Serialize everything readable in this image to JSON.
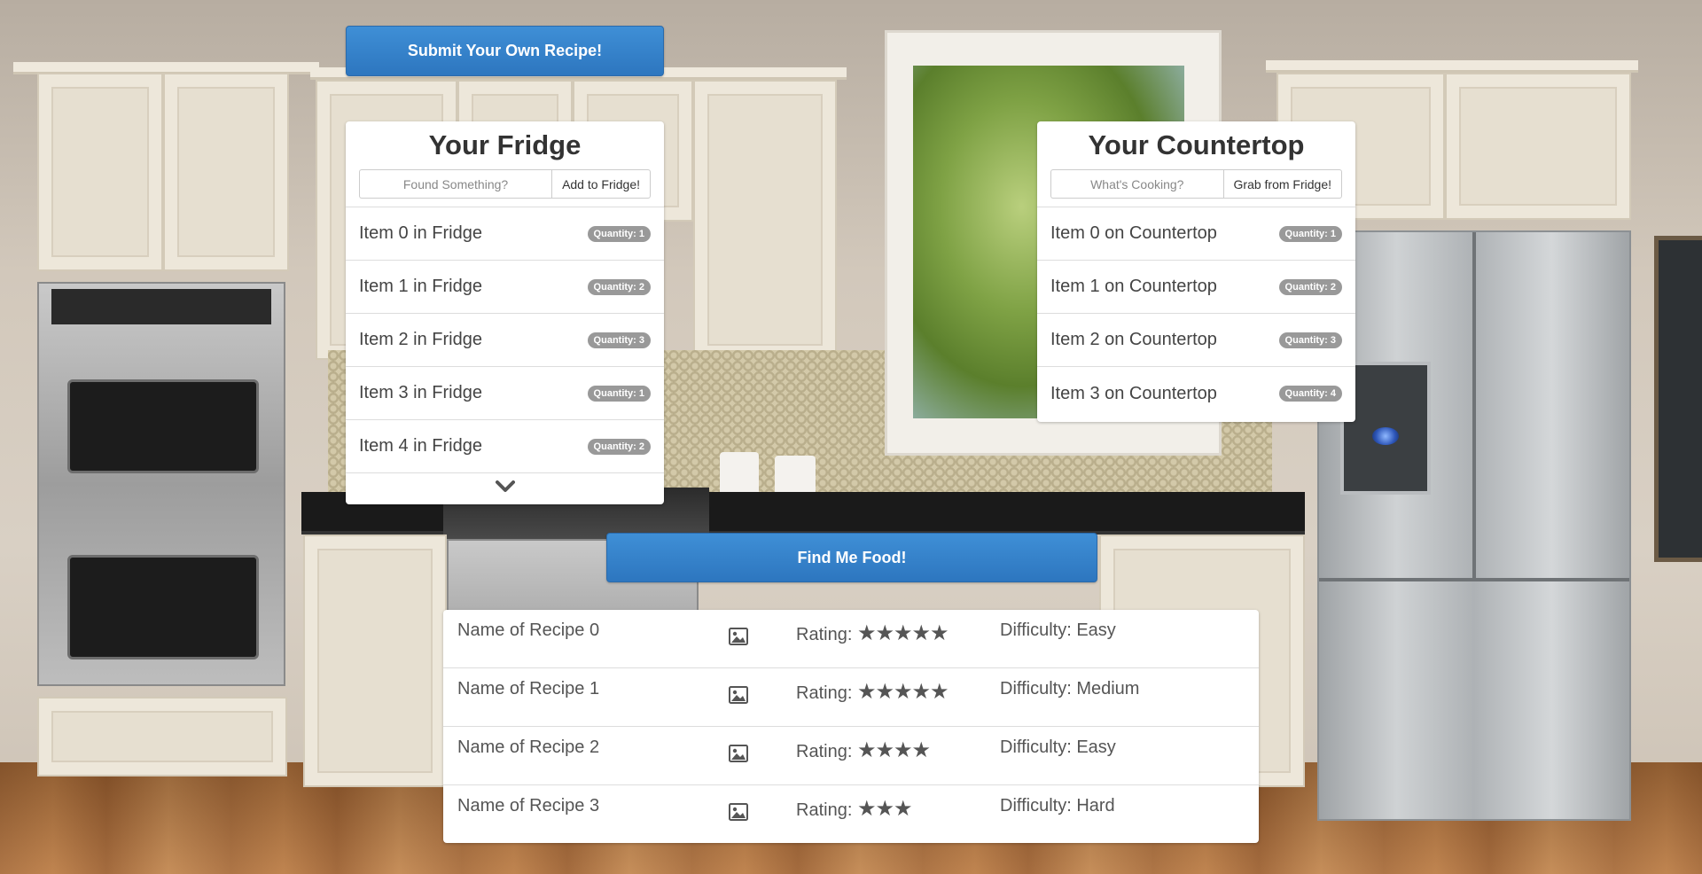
{
  "colors": {
    "primary_button": "#337ab7",
    "badge": "#999999",
    "panel": "#ffffff",
    "text": "#444444"
  },
  "submit_button": {
    "label": "Submit Your Own Recipe!"
  },
  "fridge": {
    "title": "Your Fridge",
    "input_placeholder": "Found Something?",
    "add_button": "Add to Fridge!",
    "items": [
      {
        "name": "Item 0 in Fridge",
        "quantity": "Quantity: 1"
      },
      {
        "name": "Item 1 in Fridge",
        "quantity": "Quantity: 2"
      },
      {
        "name": "Item 2 in Fridge",
        "quantity": "Quantity: 3"
      },
      {
        "name": "Item 3 in Fridge",
        "quantity": "Quantity: 1"
      },
      {
        "name": "Item 4 in Fridge",
        "quantity": "Quantity: 2"
      }
    ],
    "expand_icon": "chevron-down-icon"
  },
  "countertop": {
    "title": "Your Countertop",
    "input_placeholder": "What's Cooking?",
    "grab_button": "Grab from Fridge!",
    "items": [
      {
        "name": "Item 0 on Countertop",
        "quantity": "Quantity: 1"
      },
      {
        "name": "Item 1 on Countertop",
        "quantity": "Quantity: 2"
      },
      {
        "name": "Item 2 on Countertop",
        "quantity": "Quantity: 3"
      },
      {
        "name": "Item 3 on Countertop",
        "quantity": "Quantity: 4"
      }
    ]
  },
  "find_button": {
    "label": "Find Me Food!"
  },
  "recipes": {
    "image_icon": "picture-icon",
    "rows": [
      {
        "name": "Name of Recipe 0",
        "rating_label": "Rating:",
        "stars": "★★★★★",
        "rating": 5,
        "difficulty": "Difficulty: Easy"
      },
      {
        "name": "Name of Recipe 1",
        "rating_label": "Rating:",
        "stars": "★★★★★",
        "rating": 5,
        "difficulty": "Difficulty: Medium"
      },
      {
        "name": "Name of Recipe 2",
        "rating_label": "Rating:",
        "stars": "★★★★",
        "rating": 4,
        "difficulty": "Difficulty: Easy"
      },
      {
        "name": "Name of Recipe 3",
        "rating_label": "Rating:",
        "stars": "★★★",
        "rating": 3,
        "difficulty": "Difficulty: Hard"
      }
    ]
  }
}
